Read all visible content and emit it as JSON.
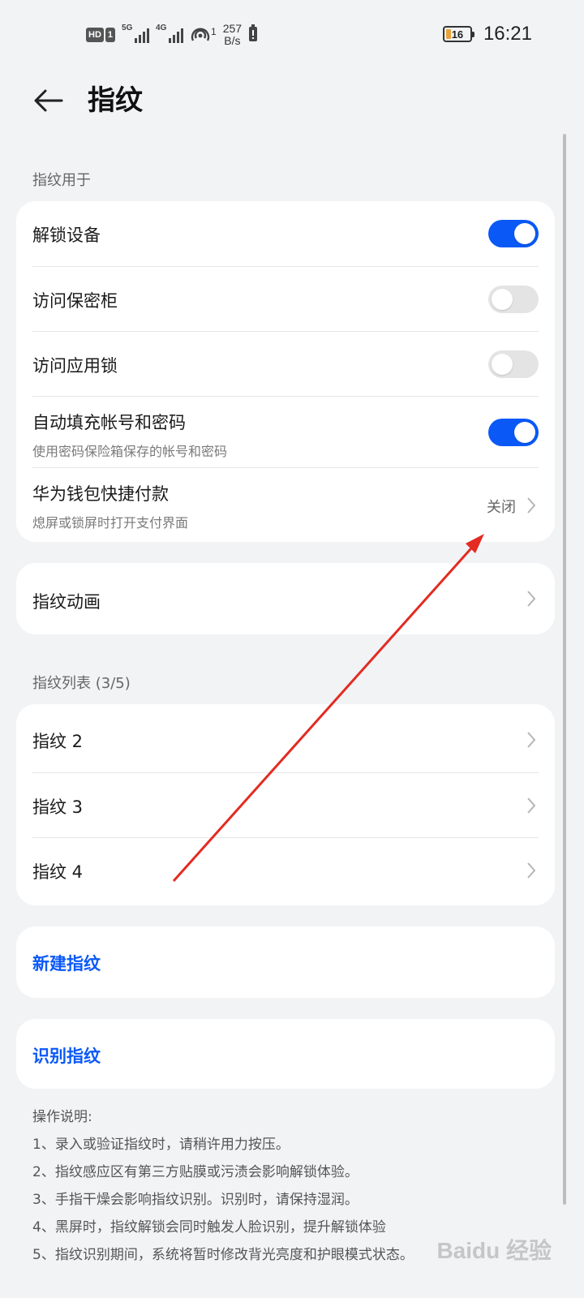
{
  "status_bar": {
    "hd_badge": "HD",
    "sim_badge": "1",
    "sim1_net": "5G",
    "sim2_net": "4G",
    "hotspot_count": "1",
    "speed_value": "257",
    "speed_unit": "B/s",
    "battery_level": "16",
    "time": "16:21"
  },
  "header": {
    "title": "指纹"
  },
  "usage_section": {
    "label": "指纹用于",
    "items": [
      {
        "title": "解锁设备",
        "toggle": "on"
      },
      {
        "title": "访问保密柜",
        "toggle": "off"
      },
      {
        "title": "访问应用锁",
        "toggle": "off"
      },
      {
        "title": "自动填充帐号和密码",
        "subtitle": "使用密码保险箱保存的帐号和密码",
        "toggle": "on"
      },
      {
        "title": "华为钱包快捷付款",
        "subtitle": "熄屏或锁屏时打开支付界面",
        "value": "关闭"
      }
    ]
  },
  "animation": {
    "title": "指纹动画"
  },
  "list_section": {
    "label": "指纹列表 (3/5)",
    "items": [
      {
        "title": "指纹 2"
      },
      {
        "title": "指纹 3"
      },
      {
        "title": "指纹 4"
      }
    ]
  },
  "actions": {
    "new_fingerprint": "新建指纹",
    "identify_fingerprint": "识别指纹"
  },
  "instructions": {
    "heading": "操作说明:",
    "lines": [
      "1、录入或验证指纹时，请稍许用力按压。",
      "2、指纹感应区有第三方贴膜或污渍会影响解锁体验。",
      "3、手指干燥会影响指纹识别。识别时，请保持湿润。",
      "4、黑屏时，指纹解锁会同时触发人脸识别，提升解锁体验",
      "5、指纹识别期间，系统将暂时修改背光亮度和护眼模式状态。"
    ]
  },
  "watermark": "Baidu 经验",
  "colors": {
    "accent": "#0a59f7",
    "annotation_arrow": "#e32b22"
  }
}
